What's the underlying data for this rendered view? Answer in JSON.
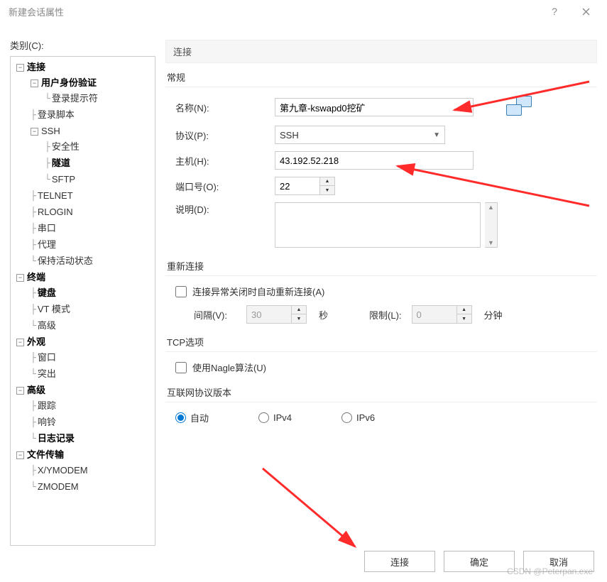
{
  "window": {
    "title": "新建会话属性"
  },
  "category_label": "类别(C):",
  "tree": {
    "connection": "连接",
    "auth": "用户身份验证",
    "login_prompt": "登录提示符",
    "login_script": "登录脚本",
    "ssh": "SSH",
    "security": "安全性",
    "tunnel": "隧道",
    "sftp": "SFTP",
    "telnet": "TELNET",
    "rlogin": "RLOGIN",
    "serial": "串口",
    "proxy": "代理",
    "keepalive": "保持活动状态",
    "terminal": "终端",
    "keyboard": "键盘",
    "vtmode": "VT 模式",
    "adv1": "高级",
    "appearance": "外观",
    "window_item": "窗口",
    "highlight": "突出",
    "advanced": "高级",
    "trace": "跟踪",
    "bell": "响铃",
    "logging": "日志记录",
    "file_transfer": "文件传输",
    "xymodem": "X/YMODEM",
    "zmodem": "ZMODEM"
  },
  "panel_header": "连接",
  "general": {
    "group": "常规",
    "name_label": "名称(N):",
    "name_value": "第九章-kswapd0挖矿",
    "protocol_label": "协议(P):",
    "protocol_value": "SSH",
    "host_label": "主机(H):",
    "host_value": "43.192.52.218",
    "port_label": "端口号(O):",
    "port_value": "22",
    "desc_label": "说明(D):"
  },
  "reconnect": {
    "group": "重新连接",
    "checkbox": "连接异常关闭时自动重新连接(A)",
    "interval_label": "间隔(V):",
    "interval_value": "30",
    "interval_unit": "秒",
    "limit_label": "限制(L):",
    "limit_value": "0",
    "limit_unit": "分钟"
  },
  "tcp": {
    "group": "TCP选项",
    "nagle": "使用Nagle算法(U)"
  },
  "ip": {
    "group": "互联网协议版本",
    "auto": "自动",
    "ipv4": "IPv4",
    "ipv6": "IPv6"
  },
  "buttons": {
    "connect": "连接",
    "ok": "确定",
    "cancel": "取消"
  },
  "watermark": "CSDN @Peterpan.exe"
}
